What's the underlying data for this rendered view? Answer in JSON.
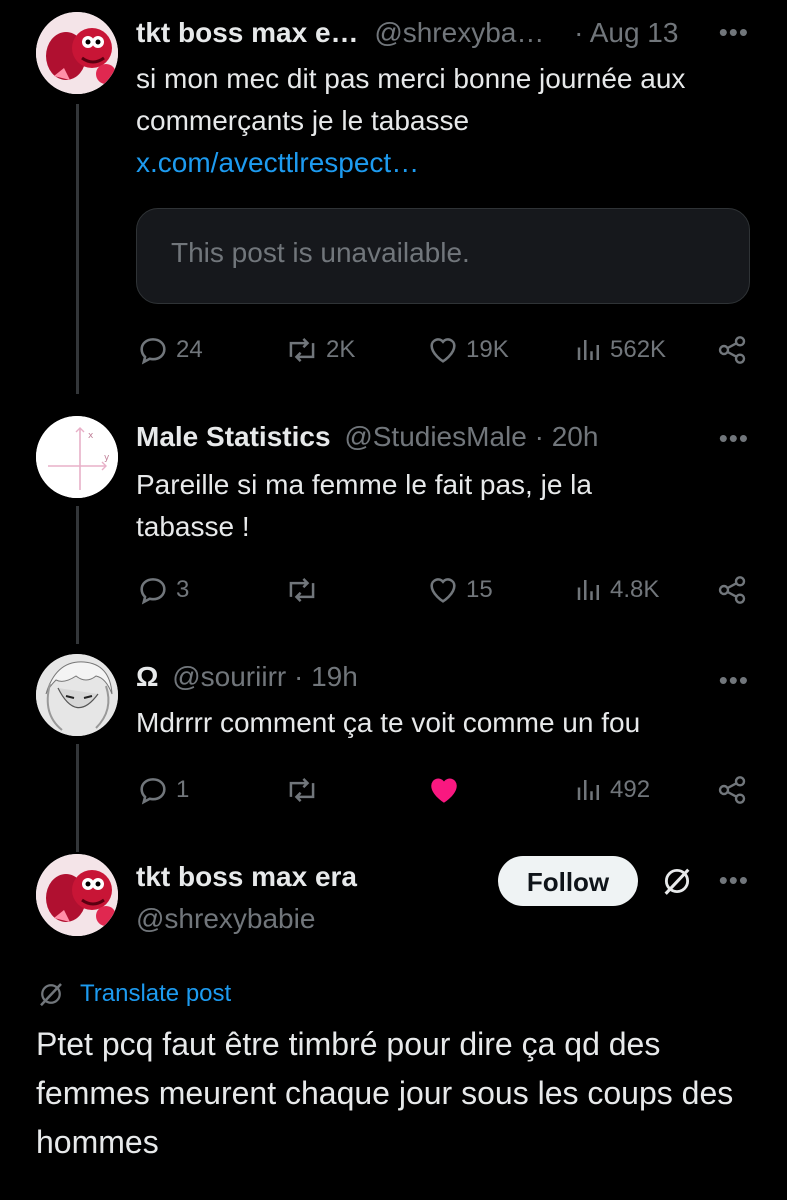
{
  "posts": [
    {
      "name": "tkt boss max e…",
      "handle": "@shrexyba…",
      "sep": "·",
      "time": "Aug 13",
      "text": "si mon mec dit pas merci bonne journée aux commerçants je le tabasse",
      "link": "x.com/avecttlrespect…",
      "quote_unavailable": "This post is unavailable.",
      "actions": {
        "replies": "24",
        "reposts": "2K",
        "likes": "19K",
        "views": "562K"
      }
    },
    {
      "name": "Male Statistics",
      "handle": "@StudiesMale",
      "sep": "·",
      "time": "20h",
      "text": "Pareille si ma femme le fait pas, je la tabasse !",
      "actions": {
        "replies": "3",
        "reposts": "",
        "likes": "15",
        "views": "4.8K"
      }
    },
    {
      "name": "Ω",
      "handle": "@souriirr",
      "sep": "·",
      "time": "19h",
      "text": "Mdrrrr comment ça te voit comme un fou",
      "actions": {
        "replies": "1",
        "reposts": "",
        "likes": "",
        "views": "492",
        "liked": true
      }
    }
  ],
  "main_post": {
    "name": "tkt boss max era",
    "handle": "@shrexybabie",
    "follow_label": "Follow",
    "translate_label": "Translate post",
    "text": "Ptet pcq faut être timbré pour dire ça qd des femmes meurent chaque jour sous les coups des hommes"
  },
  "colors": {
    "background": "#000000",
    "text": "#e7e9ea",
    "muted": "#71767b",
    "link": "#1d9bf0",
    "like_active": "#f91880",
    "thread_line": "#333639",
    "follow_bg": "#eff3f4"
  },
  "icons": [
    "reply-icon",
    "repost-icon",
    "like-icon",
    "views-icon",
    "share-icon",
    "more-icon",
    "grok-slash-icon",
    "translate-icon"
  ]
}
